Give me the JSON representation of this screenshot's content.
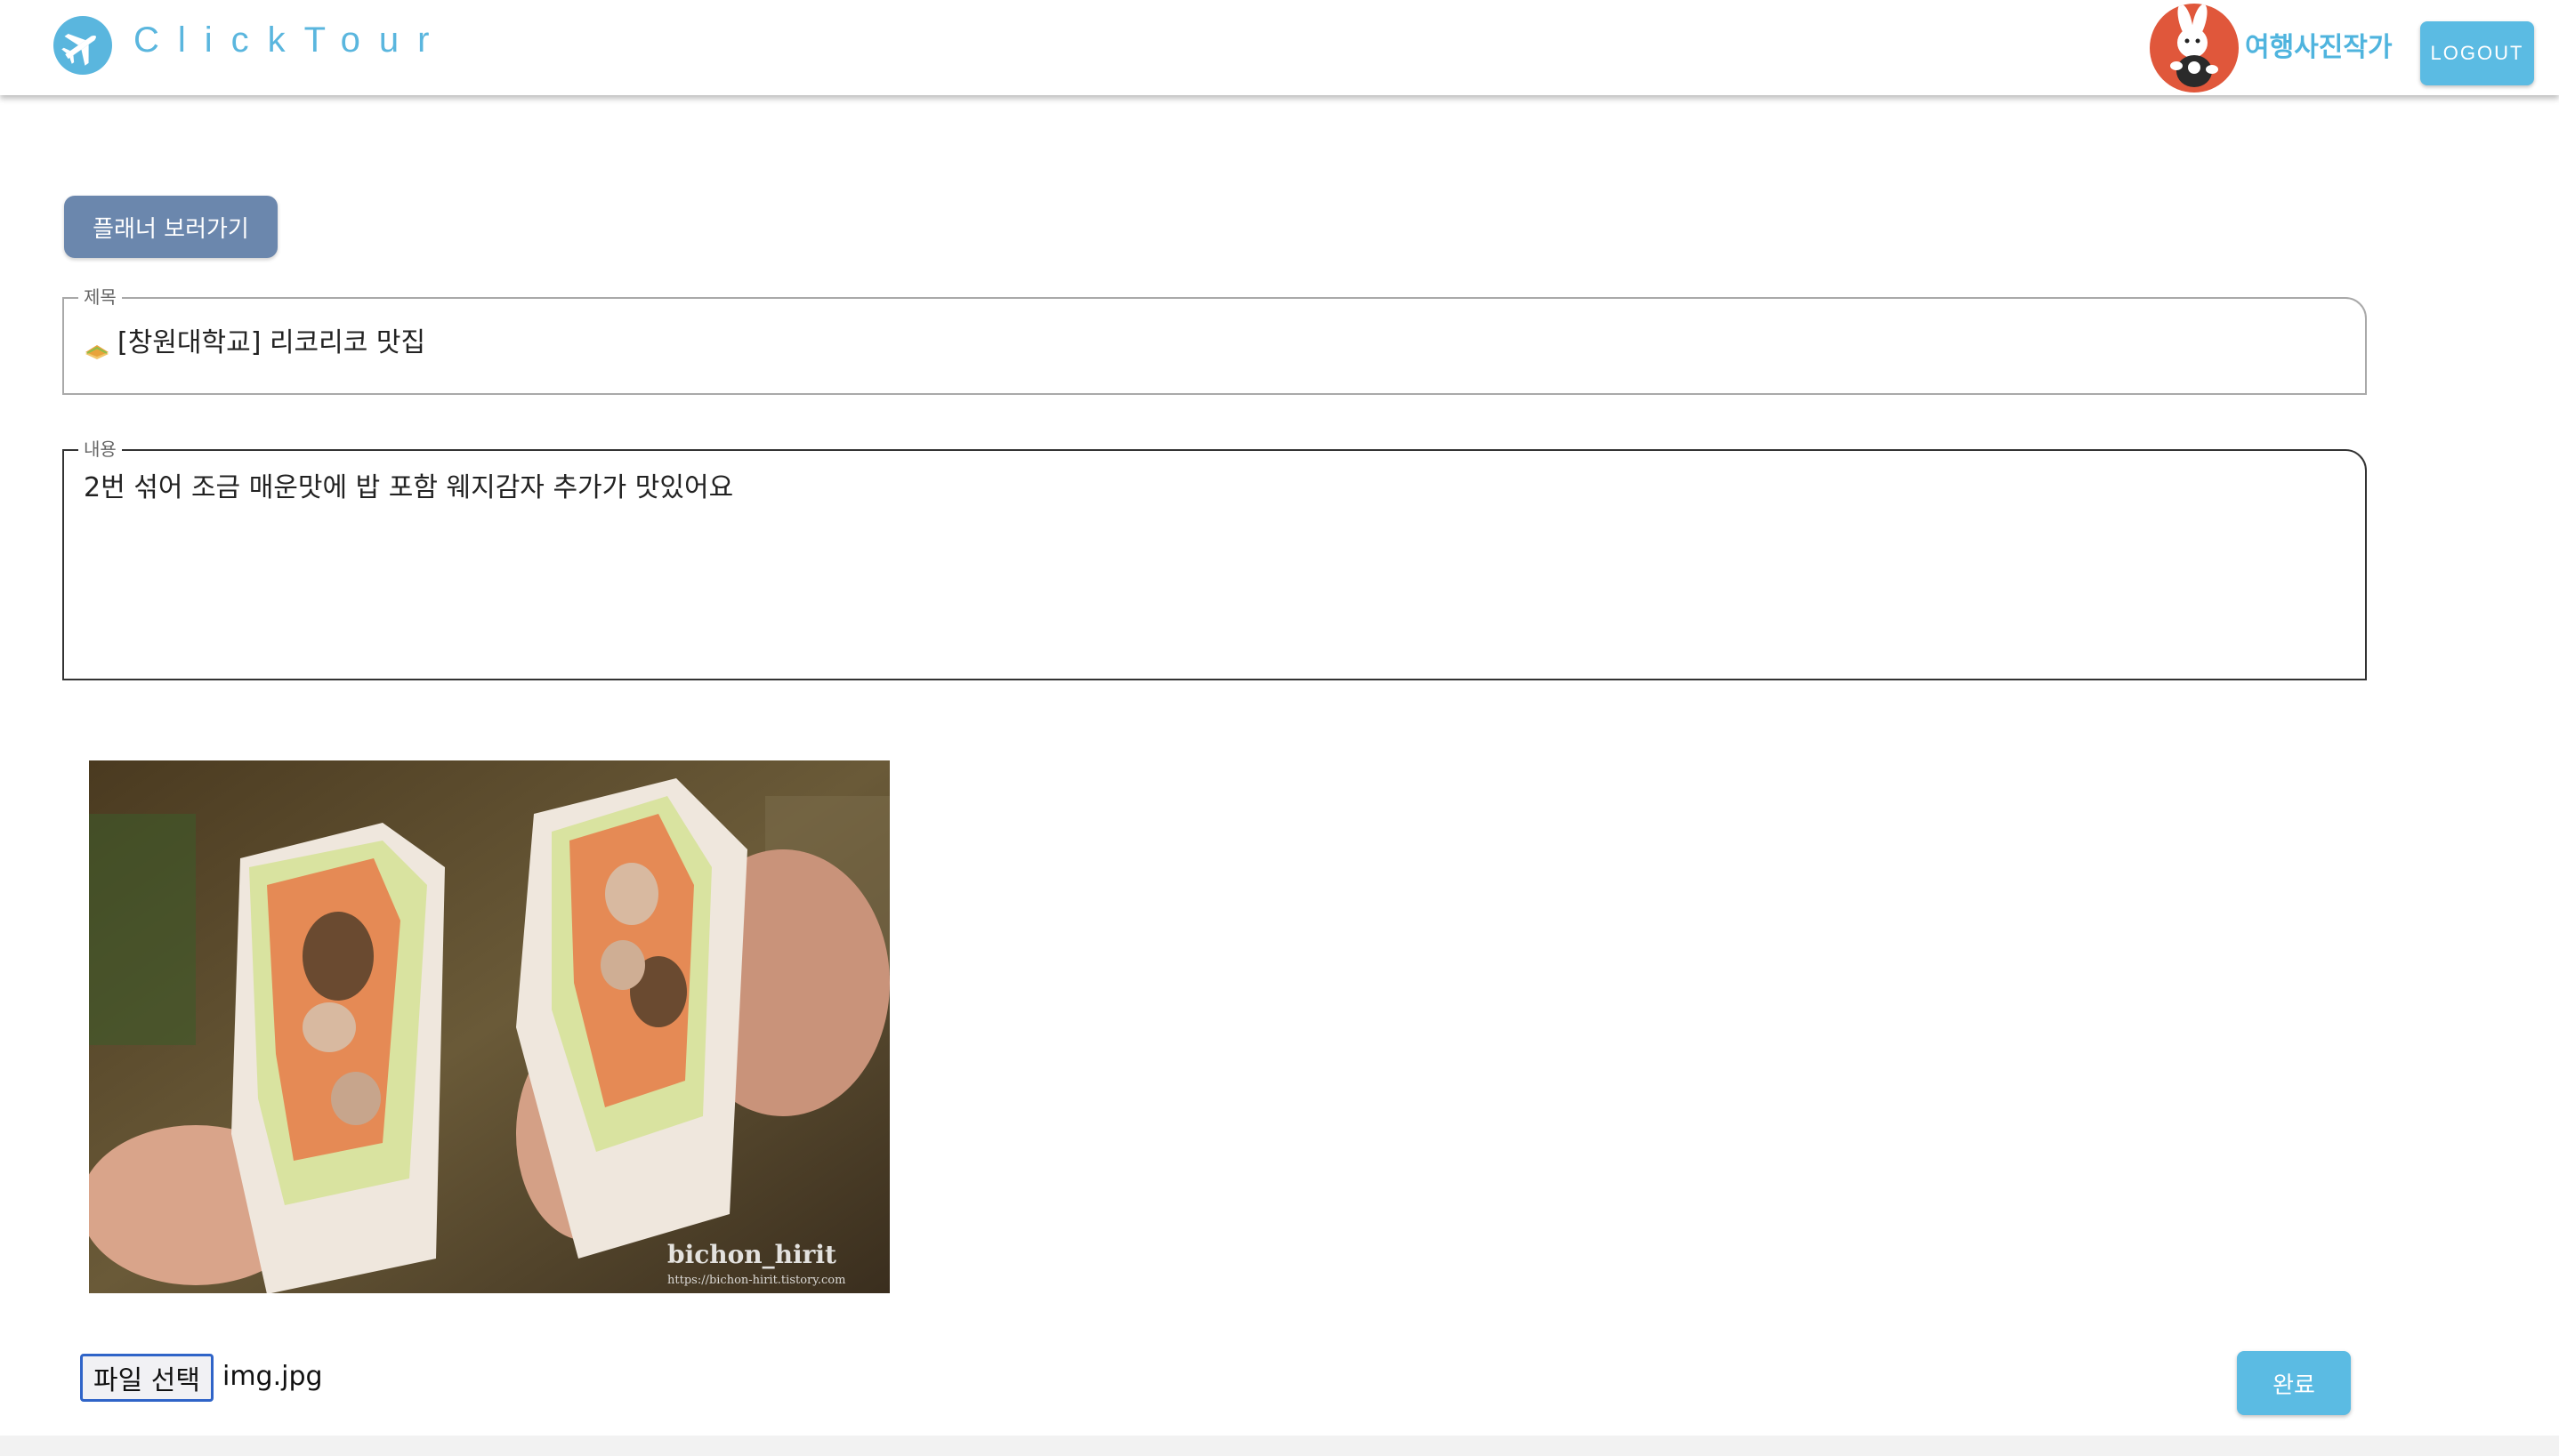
{
  "colors": {
    "brand": "#5ab6de",
    "planner_button": "#6b87ad",
    "action_button": "#5bbbe3",
    "avatar_bg": "#e0573b"
  },
  "header": {
    "brand_title": "ClickTour",
    "brand_icon": "airplane-icon",
    "user_name": "여행사진작가",
    "logout_label": "LOGOUT"
  },
  "planner_button_label": "플래너 보러가기",
  "form": {
    "title_legend": "제목",
    "title_value": "[창원대학교] 리코리코 맛집",
    "title_emoji_icon": "sandwich-icon",
    "content_legend": "내용",
    "content_value": "2번 섞어 조금 매운맛에 밥 포함 웨지감자 추가가 맛있어요"
  },
  "photo": {
    "watermark_name": "bichon_hirit",
    "watermark_url": "https://bichon-hirit.tistory.com"
  },
  "file": {
    "button_label": "파일 선택",
    "file_name": "img.jpg"
  },
  "done_label": "완료"
}
